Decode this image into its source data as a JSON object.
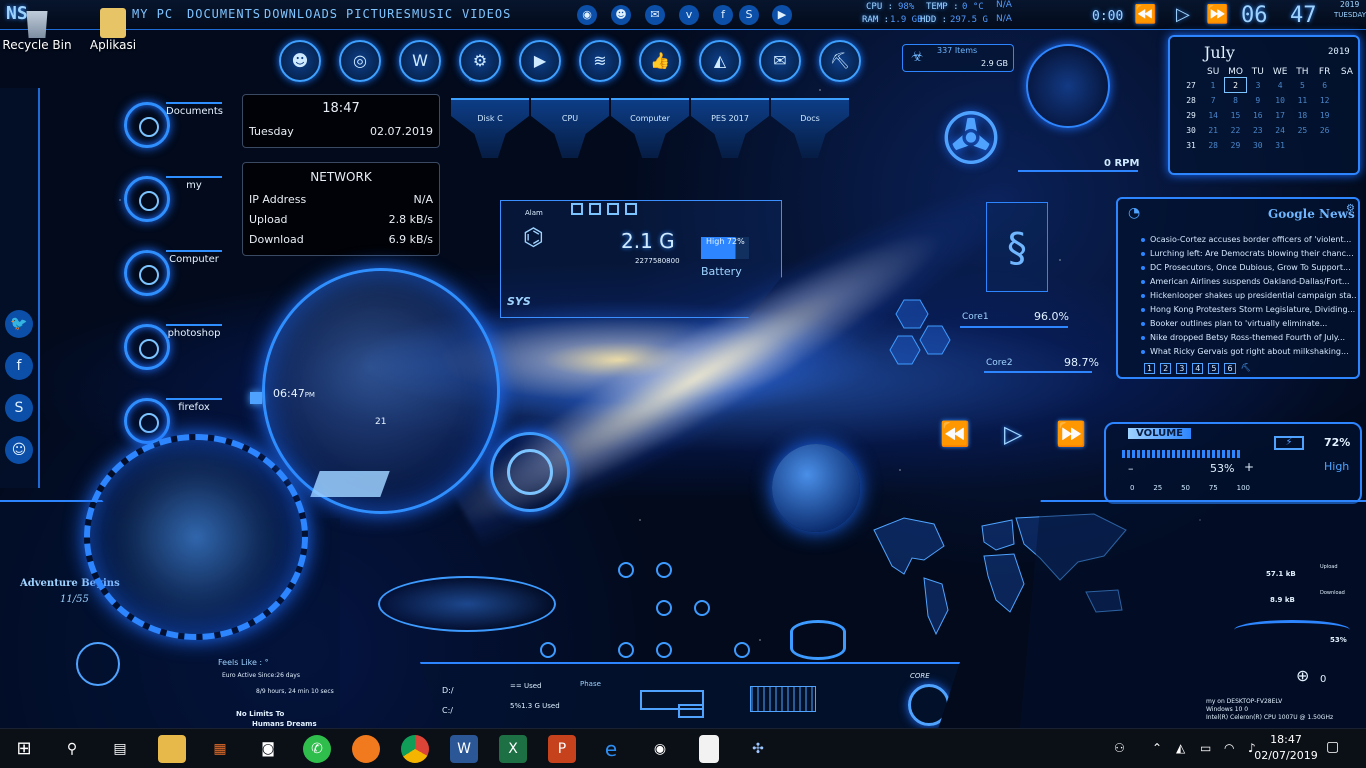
{
  "topbar": {
    "logo": "NS",
    "nav": [
      "MY PC",
      "DOCUMENTS",
      "DOWNLOADS",
      "PICTURES",
      "MUSIC",
      "VIDEOS"
    ],
    "social_icons": [
      "chrome-icon",
      "reddit-icon",
      "mail-icon",
      "vimeo-icon",
      "facebook-icon",
      "skype-icon",
      "youtube-icon"
    ],
    "cpu_label": "CPU :",
    "cpu_value": "98%",
    "ram_label": "RAM :",
    "ram_value": "1.9 GB",
    "temp_label": "TEMP :",
    "temp_value": "0 °C",
    "hdd_label": "HDD :",
    "hdd_value": "297.5 G",
    "na1": "N/A",
    "na2": "N/A",
    "media_time": "0:00",
    "clock_hour": "06",
    "clock_min": "47",
    "date_year": "2019",
    "date_day": "TUESDAY"
  },
  "desktop_icons": [
    {
      "label": "Recycle Bin"
    },
    {
      "label": "Aplikasi"
    }
  ],
  "launchers": [
    "Documents",
    "my",
    "Computer",
    "photoshop",
    "firefox"
  ],
  "app_buttons": [
    "reddit-icon",
    "chrome-icon",
    "word-icon",
    "steam-icon",
    "youtube-icon",
    "spotify-icon",
    "like-icon",
    "vlc-icon",
    "mail-icon",
    "pickaxe-icon"
  ],
  "drive_shields": [
    "Disk C",
    "CPU",
    "Computer",
    "PES 2017",
    "Docs"
  ],
  "recycle_widget": {
    "items": "337 Items",
    "size": "2.9 GB"
  },
  "clock_panel": {
    "time": "18:47",
    "day": "Tuesday",
    "date": "02.07.2019"
  },
  "network": {
    "title": "NETWORK",
    "ip_label": "IP Address",
    "ip_value": "N/A",
    "up_label": "Upload",
    "up_value": "2.8 kB/s",
    "down_label": "Download",
    "down_value": "6.9 kB/s"
  },
  "sys_widget": {
    "value": "2.1 G",
    "number": "2277580800",
    "battery_level": "High 72%",
    "battery_label": "Battery",
    "sys_label": "SYS",
    "alarm_label": "Alam"
  },
  "fan": {
    "rpm": "0 RPM"
  },
  "cores": {
    "core1_label": "Core1",
    "core1_value": "96.0%",
    "core2_label": "Core2",
    "core2_value": "98.7%"
  },
  "globe": {
    "time": "06:47",
    "ampm": "PM",
    "num": "21"
  },
  "calendar": {
    "month": "July",
    "year": "2019",
    "weekdays": [
      "SU",
      "MO",
      "TU",
      "WE",
      "TH",
      "FR",
      "SA"
    ],
    "weeks": [
      [
        "27",
        "1",
        "2",
        "3",
        "4",
        "5",
        "6"
      ],
      [
        "28",
        "7",
        "8",
        "9",
        "10",
        "11",
        "12"
      ],
      [
        "29",
        "14",
        "15",
        "16",
        "17",
        "18",
        "19"
      ],
      [
        "30",
        "21",
        "22",
        "23",
        "24",
        "25",
        "26"
      ],
      [
        "31",
        "28",
        "29",
        "30",
        "31",
        "",
        ""
      ]
    ]
  },
  "news": {
    "title": "Google News",
    "items": [
      "Ocasio-Cortez accuses border officers of 'violent...",
      "Lurching left: Are Democrats blowing their chanc...",
      "DC Prosecutors, Once Dubious, Grow To Support...",
      "American Airlines suspends Oakland-Dallas/Fort...",
      "Hickenlooper shakes up presidential campaign sta...",
      "Hong Kong Protesters Storm Legislature, Dividing...",
      "Booker outlines plan to 'virtually eliminate...",
      "Nike dropped Betsy Ross-themed Fourth of July...",
      "What Ricky Gervais got right about milkshaking..."
    ],
    "pages": [
      "1",
      "2",
      "3",
      "4",
      "5",
      "6"
    ]
  },
  "volume": {
    "label": "VOLUME",
    "percent": "53%",
    "battery": "72%",
    "battery_state": "High",
    "scale": [
      "0",
      "25",
      "50",
      "75",
      "100"
    ],
    "minus": "–",
    "plus": "+",
    "level": 0.53
  },
  "bottom_left": {
    "adventure": "Adventure Begins",
    "count": "11/55",
    "feels": "Feels Like : °",
    "active": "Euro Active Since:26 days",
    "uptime": "8/9 hours, 24 min 10 secs",
    "motto1": "No Limits To",
    "motto2": "Humans Dreams"
  },
  "bottom_center": {
    "d_label": "D:/",
    "c_label": "C:/",
    "used1": "== Used",
    "used2": "5%1.3 G Used",
    "phase": "Phase",
    "core": "CORE"
  },
  "bottom_right": {
    "upload_val": "57.1 kB",
    "download_val": "8.9 kB",
    "upload_lbl": "Upload",
    "download_lbl": "Download",
    "pct": "53%",
    "ring_val": "0",
    "pc_line1": "my on DESKTOP-FV28ELV",
    "pc_line2": "Windows 10 0",
    "pc_line3": "Intel(R) Celeron(R) CPU 1007U @ 1.50GHz"
  },
  "taskbar": {
    "apps": [
      "windows-start-icon",
      "search-icon",
      "task-view-icon",
      "file-explorer-icon",
      "store-icon",
      "camera-icon",
      "whatsapp-icon",
      "firefox-icon",
      "chrome-icon",
      "word-icon",
      "excel-icon",
      "powerpoint-icon",
      "edge-icon",
      "webcam-icon",
      "document-icon",
      "pes-icon"
    ],
    "time": "18:47",
    "date": "02/07/2019"
  }
}
